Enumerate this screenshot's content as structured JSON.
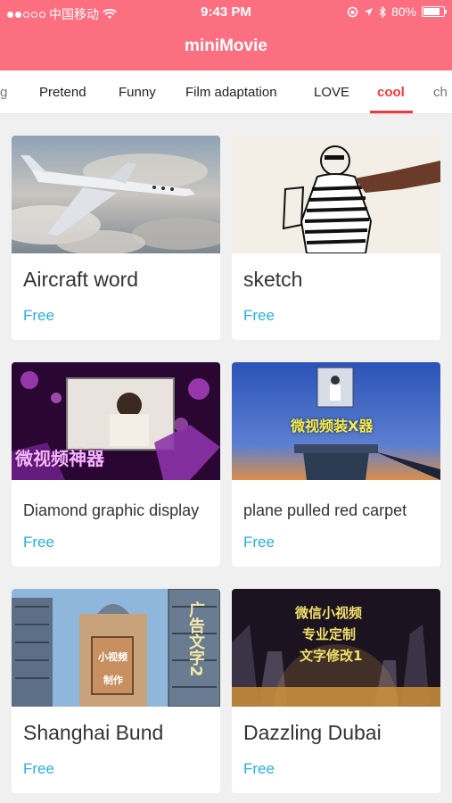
{
  "status_bar": {
    "carrier": "中国移动",
    "time": "9:43 PM",
    "battery": "80%",
    "battery_level": 0.8
  },
  "app": {
    "title": "miniMovie"
  },
  "tabs": [
    {
      "label": "g",
      "partial": true
    },
    {
      "label": "Pretend"
    },
    {
      "label": "Funny"
    },
    {
      "label": "Film adaptation"
    },
    {
      "label": "LOVE"
    },
    {
      "label": "cool",
      "active": true
    },
    {
      "label": "ch",
      "partial": true
    }
  ],
  "cards": [
    {
      "title": "Aircraft word",
      "price": "Free"
    },
    {
      "title": "sketch",
      "price": "Free"
    },
    {
      "title": "Diamond graphic display",
      "price": "Free",
      "thumb_text": "微视频神器"
    },
    {
      "title": "plane pulled red carpet",
      "price": "Free",
      "thumb_text": "微视频装X器"
    },
    {
      "title": "Shanghai Bund",
      "price": "Free",
      "thumb_text_a": "小视频",
      "thumb_text_b": "制作",
      "thumb_text_c": "广告文字2"
    },
    {
      "title": "Dazzling Dubai",
      "price": "Free",
      "thumb_text_a": "微信小视频",
      "thumb_text_b": "专业定制",
      "thumb_text_c": "文字修改1"
    }
  ]
}
